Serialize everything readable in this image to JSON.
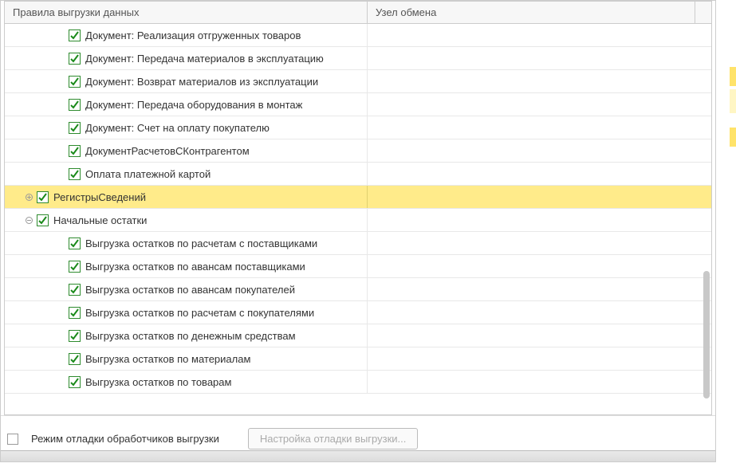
{
  "headers": {
    "col1": "Правила выгрузки данных",
    "col2": "Узел обмена"
  },
  "rows": [
    {
      "indent": 56,
      "expander": "none",
      "checked": true,
      "label": "Документ: Реализация отгруженных товаров",
      "selected": false
    },
    {
      "indent": 56,
      "expander": "none",
      "checked": true,
      "label": "Документ: Передача материалов в эксплуатацию",
      "selected": false
    },
    {
      "indent": 56,
      "expander": "none",
      "checked": true,
      "label": "Документ: Возврат материалов из эксплуатации",
      "selected": false
    },
    {
      "indent": 56,
      "expander": "none",
      "checked": true,
      "label": "Документ: Передача оборудования в монтаж",
      "selected": false
    },
    {
      "indent": 56,
      "expander": "none",
      "checked": true,
      "label": "Документ: Счет на оплату покупателю",
      "selected": false
    },
    {
      "indent": 56,
      "expander": "none",
      "checked": true,
      "label": "ДокументРасчетовСКонтрагентом",
      "selected": false
    },
    {
      "indent": 56,
      "expander": "none",
      "checked": true,
      "label": "Оплата платежной картой",
      "selected": false
    },
    {
      "indent": 16,
      "expander": "plus",
      "checked": true,
      "label": "РегистрыСведений",
      "selected": true
    },
    {
      "indent": 16,
      "expander": "minus",
      "checked": true,
      "label": "Начальные остатки",
      "selected": false
    },
    {
      "indent": 56,
      "expander": "none",
      "checked": true,
      "label": "Выгрузка остатков по расчетам с поставщиками",
      "selected": false
    },
    {
      "indent": 56,
      "expander": "none",
      "checked": true,
      "label": "Выгрузка остатков по авансам поставщиками",
      "selected": false
    },
    {
      "indent": 56,
      "expander": "none",
      "checked": true,
      "label": "Выгрузка остатков по авансам покупателей",
      "selected": false
    },
    {
      "indent": 56,
      "expander": "none",
      "checked": true,
      "label": "Выгрузка остатков по расчетам с покупателями",
      "selected": false
    },
    {
      "indent": 56,
      "expander": "none",
      "checked": true,
      "label": "Выгрузка остатков по денежным средствам",
      "selected": false
    },
    {
      "indent": 56,
      "expander": "none",
      "checked": true,
      "label": "Выгрузка остатков по материалам",
      "selected": false
    },
    {
      "indent": 56,
      "expander": "none",
      "checked": true,
      "label": "Выгрузка остатков по товарам",
      "selected": false
    }
  ],
  "footer": {
    "debug_label": "Режим отладки обработчиков выгрузки",
    "button_label": "Настройка отладки выгрузки..."
  }
}
